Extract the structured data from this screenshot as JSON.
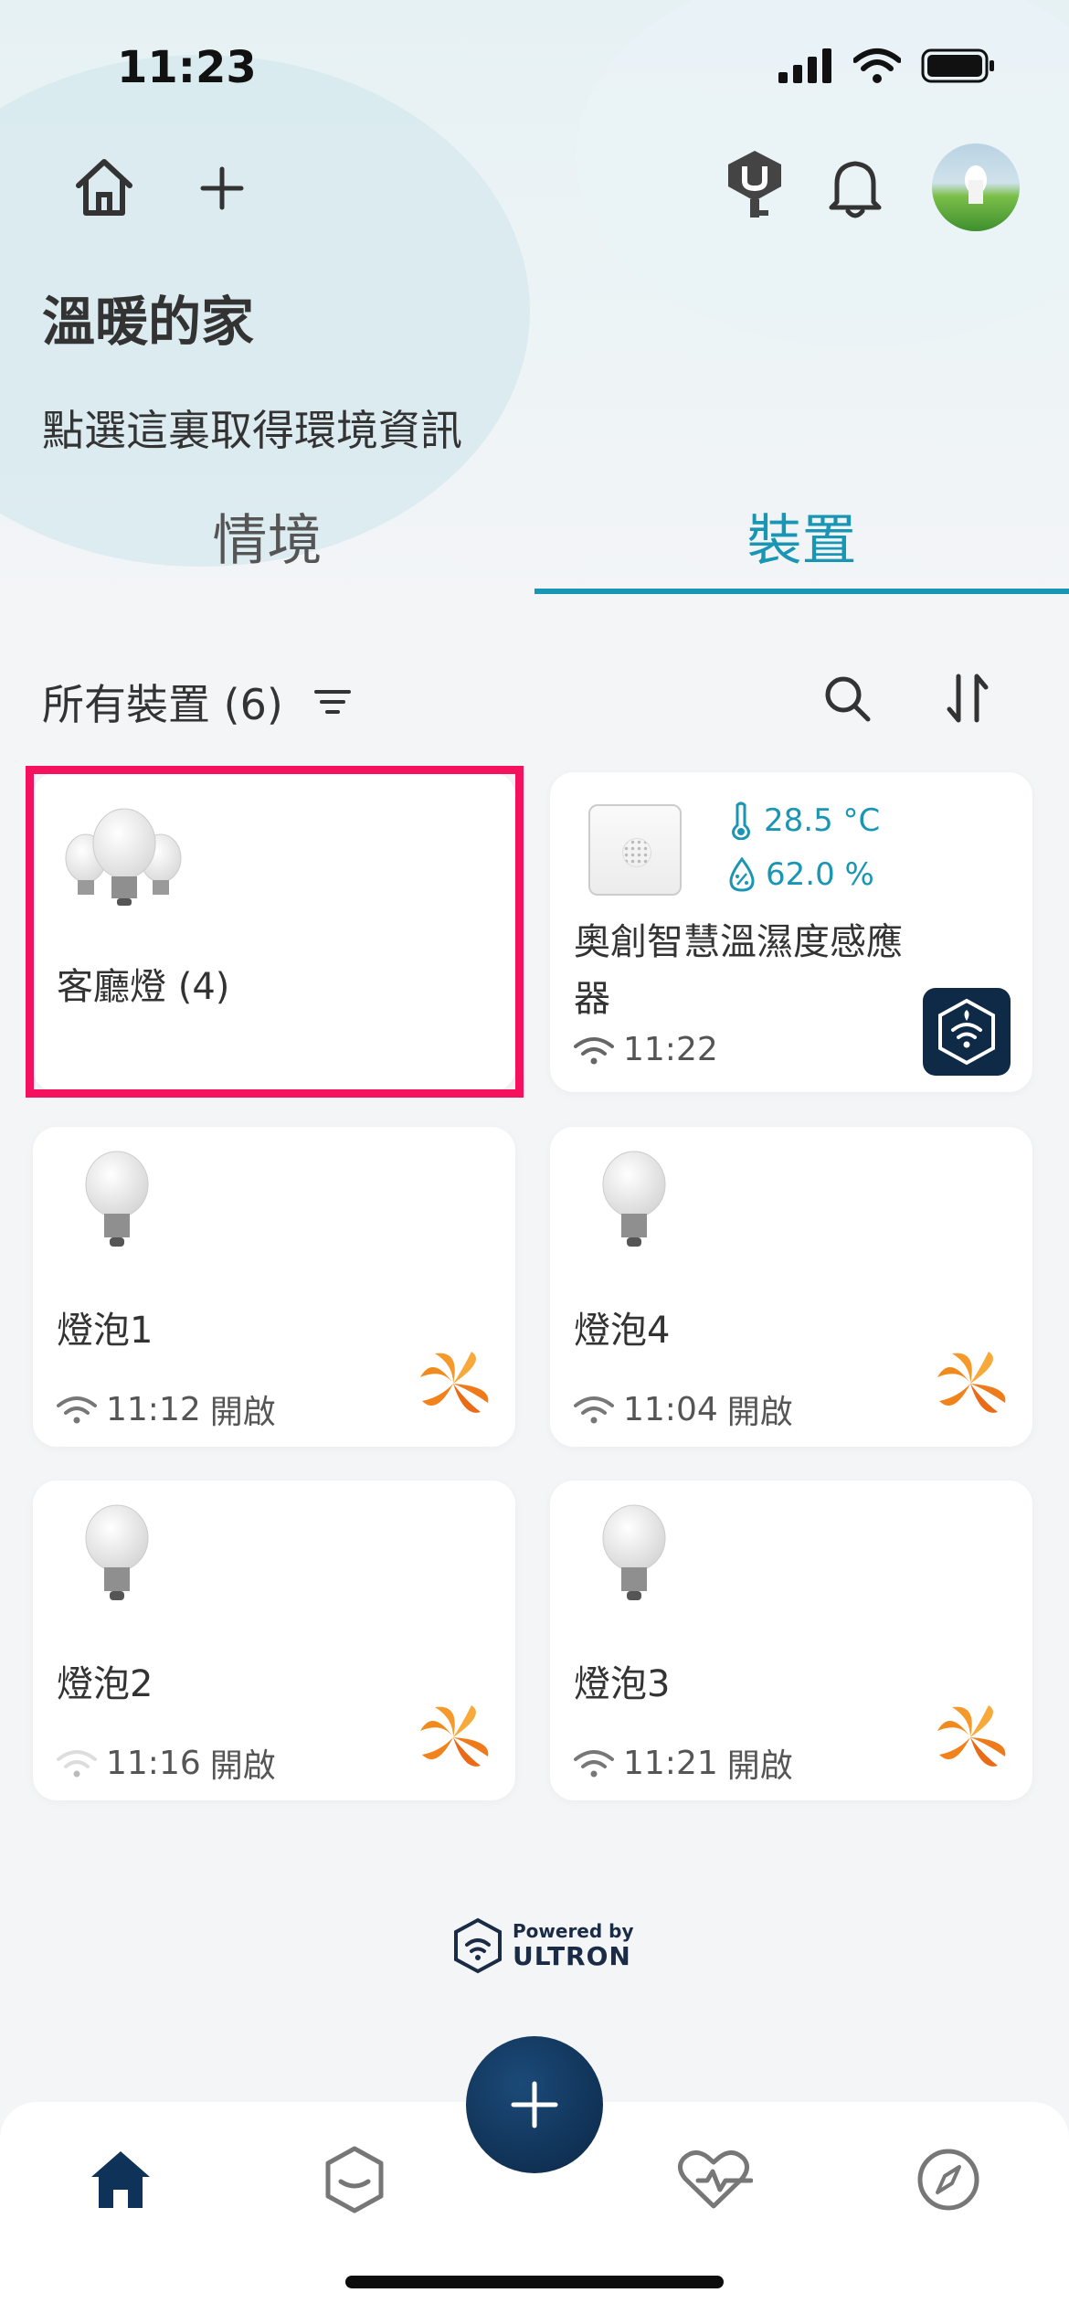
{
  "status_bar": {
    "time": "11:23"
  },
  "header": {
    "home_title": "溫暖的家",
    "env_link": "點選這裏取得環境資訊"
  },
  "tabs": [
    {
      "label": "情境",
      "selected": false
    },
    {
      "label": "裝置",
      "selected": true
    }
  ],
  "device_list": {
    "title": "所有裝置 (6)",
    "accent_color": "#1a96b5"
  },
  "devices": [
    {
      "name": "客廳燈 (4)",
      "type": "light-group",
      "icon": "bulb-group-icon"
    },
    {
      "name": "奧創智慧溫濕度感應器",
      "type": "sensor",
      "temperature": "28.5 °C",
      "humidity": "62.0 %",
      "time": "11:22",
      "brand_icon": "ultron-icon"
    },
    {
      "name": "燈泡1",
      "time": "11:12",
      "state": "開啟",
      "brand_icon": "orange-brand-icon"
    },
    {
      "name": "燈泡4",
      "time": "11:04",
      "state": "開啟",
      "brand_icon": "orange-brand-icon"
    },
    {
      "name": "燈泡2",
      "time": "11:16",
      "state": "開啟",
      "brand_icon": "orange-brand-icon"
    },
    {
      "name": "燈泡3",
      "time": "11:21",
      "state": "開啟",
      "brand_icon": "orange-brand-icon"
    }
  ],
  "footer": {
    "powered_by": "Powered by",
    "brand": "ULTRON"
  },
  "bottom_nav": [
    {
      "icon": "home-icon",
      "selected": true
    },
    {
      "icon": "hexagon-icon",
      "selected": false
    },
    {
      "icon": "heart-pulse-icon",
      "selected": false
    },
    {
      "icon": "compass-icon",
      "selected": false
    }
  ],
  "highlight_color": "#f5115d"
}
